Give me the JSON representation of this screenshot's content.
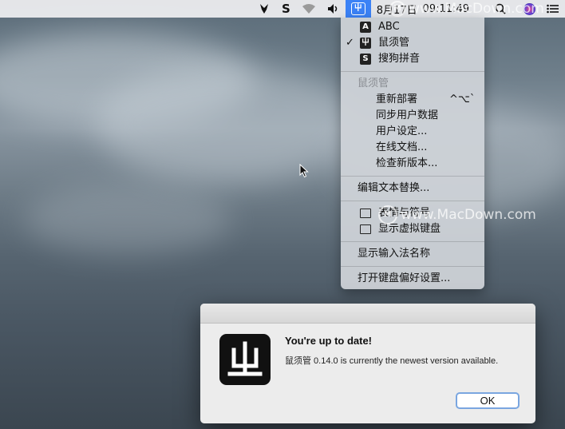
{
  "menubar": {
    "date": "8月17日",
    "time": "09:11:49",
    "ime_badge": "⼬",
    "sogou_glyph": "S",
    "watermark": "www.MacDown.com"
  },
  "ime_menu": {
    "sources": [
      {
        "label": "ABC",
        "icon": "A",
        "checked": false
      },
      {
        "label": "鼠须管",
        "icon": "⼬",
        "checked": true
      },
      {
        "label": "搜狗拼音",
        "icon": "S",
        "checked": false
      }
    ],
    "section_header": "鼠须管",
    "squirrel_items": [
      {
        "label": "重新部署",
        "shortcut": "^⌥`"
      },
      {
        "label": "同步用户数据"
      },
      {
        "label": "用户设定..."
      },
      {
        "label": "在线文档..."
      },
      {
        "label": "检查新版本..."
      }
    ],
    "edit_replacement": "编辑文本替换...",
    "emoji_symbols": "表情与符号",
    "show_keyboard": "显示虚拟键盘",
    "show_ime_name": "显示输入法名称",
    "open_keyboard_prefs": "打开键盘偏好设置..."
  },
  "overlay_watermark": "www.MacDown.com",
  "dialog": {
    "title": "You're up to date!",
    "message": "鼠须管 0.14.0 is currently the newest version available.",
    "ok_label": "OK",
    "app_icon_glyph": "⼬"
  },
  "colors": {
    "menu_highlight": "#3b82f6",
    "ok_border": "#7aa6e0"
  }
}
